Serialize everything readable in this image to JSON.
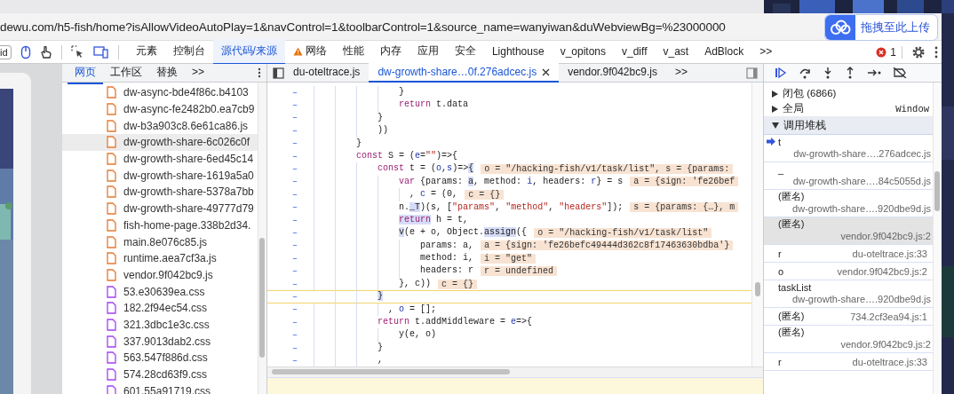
{
  "browser": {
    "url": "dewu.com/h5-fish/home?isAllowVideoAutoPlay=1&navControl=1&toolbarControl=1&source_name=wanyiwan&duWebviewBg=%23000000",
    "upload_button": "拖拽至此上传"
  },
  "devtools": {
    "search_field": "id",
    "tabs": [
      {
        "label": "元素",
        "selected": false,
        "warning": false
      },
      {
        "label": "控制台",
        "selected": false,
        "warning": false
      },
      {
        "label": "源代码/来源",
        "selected": true,
        "warning": false
      },
      {
        "label": "网络",
        "selected": false,
        "warning": true
      },
      {
        "label": "性能",
        "selected": false,
        "warning": false
      },
      {
        "label": "内存",
        "selected": false,
        "warning": false
      },
      {
        "label": "应用",
        "selected": false,
        "warning": false
      },
      {
        "label": "安全",
        "selected": false,
        "warning": false
      },
      {
        "label": "Lighthouse",
        "selected": false,
        "warning": false
      },
      {
        "label": "v_opitons",
        "selected": false,
        "warning": false
      },
      {
        "label": "v_diff",
        "selected": false,
        "warning": false
      },
      {
        "label": "v_ast",
        "selected": false,
        "warning": false
      },
      {
        "label": "AdBlock",
        "selected": false,
        "warning": false
      }
    ],
    "more": ">>",
    "error_count": "1"
  },
  "navigator": {
    "tabs": [
      {
        "label": "网页",
        "selected": true
      },
      {
        "label": "工作区",
        "selected": false
      },
      {
        "label": "替换",
        "selected": false
      }
    ],
    "more": ">>",
    "files": [
      {
        "name": "dw-async-bde4f86c.b4103",
        "kind": "js",
        "selected": false
      },
      {
        "name": "dw-async-fe2482b0.ea7cb9",
        "kind": "js",
        "selected": false
      },
      {
        "name": "dw-b3a903c8.6e61ca86.js",
        "kind": "js",
        "selected": false
      },
      {
        "name": "dw-growth-share-6c026c0f",
        "kind": "js",
        "selected": true
      },
      {
        "name": "dw-growth-share-6ed45c14",
        "kind": "js",
        "selected": false
      },
      {
        "name": "dw-growth-share-1619a5a0",
        "kind": "js",
        "selected": false
      },
      {
        "name": "dw-growth-share-5378a7bb",
        "kind": "js",
        "selected": false
      },
      {
        "name": "dw-growth-share-49777d79",
        "kind": "js",
        "selected": false
      },
      {
        "name": "fish-home-page.338b2d34.",
        "kind": "js",
        "selected": false
      },
      {
        "name": "main.8e076c85.js",
        "kind": "js",
        "selected": false
      },
      {
        "name": "runtime.aea7cf3a.js",
        "kind": "js",
        "selected": false
      },
      {
        "name": "vendor.9f042bc9.js",
        "kind": "js",
        "selected": false
      },
      {
        "name": "53.e30639ea.css",
        "kind": "css",
        "selected": false
      },
      {
        "name": "182.2f94ec54.css",
        "kind": "css",
        "selected": false
      },
      {
        "name": "321.3dbc1e3c.css",
        "kind": "css",
        "selected": false
      },
      {
        "name": "337.9013dab2.css",
        "kind": "css",
        "selected": false
      },
      {
        "name": "563.547f886d.css",
        "kind": "css",
        "selected": false
      },
      {
        "name": "574.28cd63f9.css",
        "kind": "css",
        "selected": false
      },
      {
        "name": "601.55a91719.css",
        "kind": "css",
        "selected": false
      }
    ]
  },
  "editor": {
    "tabs": [
      {
        "label": "du-oteltrace.js",
        "selected": false
      },
      {
        "label": "dw-growth-share…0f.276adcec.js",
        "selected": true
      },
      {
        "label": "vendor.9f042bc9.js",
        "selected": false
      }
    ],
    "more": ">>",
    "lines": [
      {
        "gutter": "–",
        "current": false,
        "tokens": [
          {
            "kind": "plain",
            "text": "                }"
          }
        ]
      },
      {
        "gutter": "–",
        "current": false,
        "tokens": [
          {
            "kind": "keyword",
            "text": "                return"
          },
          {
            "kind": "plain",
            "text": " t.data"
          }
        ]
      },
      {
        "gutter": "–",
        "current": false,
        "tokens": [
          {
            "kind": "plain",
            "text": "            }"
          }
        ]
      },
      {
        "gutter": "–",
        "current": false,
        "tokens": [
          {
            "kind": "plain",
            "text": "            ))"
          }
        ]
      },
      {
        "gutter": "–",
        "current": false,
        "tokens": [
          {
            "kind": "plain",
            "text": "        }"
          }
        ]
      },
      {
        "gutter": "–",
        "current": false,
        "tokens": [
          {
            "kind": "keyword",
            "text": "        const"
          },
          {
            "kind": "plain",
            "text": " S = ("
          },
          {
            "kind": "ident",
            "text": "e"
          },
          {
            "kind": "plain",
            "text": "="
          },
          {
            "kind": "string",
            "text": "\"\""
          },
          {
            "kind": "plain",
            "text": ")=>{"
          }
        ]
      },
      {
        "gutter": "–",
        "current": false,
        "tokens": [
          {
            "kind": "keyword",
            "text": "            const"
          },
          {
            "kind": "plain",
            "text": " t = ("
          },
          {
            "kind": "ident",
            "text": "o"
          },
          {
            "kind": "plain",
            "text": ","
          },
          {
            "kind": "ident",
            "text": "s"
          },
          {
            "kind": "plain",
            "text": ")=>"
          },
          {
            "kind": "mark",
            "text": "{"
          }
        ],
        "values": [
          "o = \"/hacking-fish/v1/task/list\", s = {params:"
        ]
      },
      {
        "gutter": "–",
        "current": false,
        "tokens": [
          {
            "kind": "keyword",
            "text": "                var"
          },
          {
            "kind": "plain",
            "text": " {params: "
          },
          {
            "kind": "mark",
            "text": "a"
          },
          {
            "kind": "plain",
            "text": ", method: "
          },
          {
            "kind": "ident",
            "text": "i"
          },
          {
            "kind": "plain",
            "text": ", headers: "
          },
          {
            "kind": "ident",
            "text": "r"
          },
          {
            "kind": "plain",
            "text": "} = s"
          }
        ],
        "values": [
          "a = {sign: 'fe26bef"
        ]
      },
      {
        "gutter": "–",
        "current": false,
        "tokens": [
          {
            "kind": "plain",
            "text": "                  , "
          },
          {
            "kind": "ident",
            "text": "c"
          },
          {
            "kind": "plain",
            "text": " = (0,"
          }
        ],
        "values": [
          "c = {}"
        ]
      },
      {
        "gutter": "–",
        "current": false,
        "tokens": [
          {
            "kind": "plain",
            "text": "                n."
          },
          {
            "kind": "mark",
            "text": "_T"
          },
          {
            "kind": "plain",
            "text": ")(s, ["
          },
          {
            "kind": "string",
            "text": "\"params\""
          },
          {
            "kind": "plain",
            "text": ", "
          },
          {
            "kind": "string",
            "text": "\"method\""
          },
          {
            "kind": "plain",
            "text": ", "
          },
          {
            "kind": "string",
            "text": "\"headers\""
          },
          {
            "kind": "plain",
            "text": "]);"
          }
        ],
        "values": [
          "s = {params: {…}, m"
        ]
      },
      {
        "gutter": "–",
        "current": false,
        "tokens": [
          {
            "kind": "mark-keyword",
            "text": "                return"
          },
          {
            "kind": "plain",
            "text": " h = t,"
          }
        ]
      },
      {
        "gutter": "–",
        "current": false,
        "tokens": [
          {
            "kind": "mark",
            "text": "                v"
          },
          {
            "kind": "plain",
            "text": "(e + o, Object."
          },
          {
            "kind": "mark",
            "text": "assign"
          },
          {
            "kind": "plain",
            "text": "({"
          }
        ],
        "values": [
          "o = \"/hacking-fish/v1/task/list\""
        ]
      },
      {
        "gutter": "–",
        "current": false,
        "tokens": [
          {
            "kind": "plain",
            "text": "                    params: a,"
          }
        ],
        "values": [
          "a = {sign: 'fe26befc49444d362c8f17463630bdba'}"
        ]
      },
      {
        "gutter": "–",
        "current": false,
        "tokens": [
          {
            "kind": "plain",
            "text": "                    method: i,"
          }
        ],
        "values": [
          "i = \"get\""
        ]
      },
      {
        "gutter": "–",
        "current": false,
        "tokens": [
          {
            "kind": "plain",
            "text": "                    headers: r"
          }
        ],
        "values": [
          "r = undefined"
        ]
      },
      {
        "gutter": "–",
        "current": false,
        "tokens": [
          {
            "kind": "plain",
            "text": "                }, c))"
          }
        ],
        "values": [
          "c = {}"
        ]
      },
      {
        "gutter": "–",
        "current": true,
        "tokens": [
          {
            "kind": "mark",
            "text": "            }"
          }
        ]
      },
      {
        "gutter": "–",
        "current": false,
        "tokens": [
          {
            "kind": "plain",
            "text": "              , "
          },
          {
            "kind": "ident",
            "text": "o"
          },
          {
            "kind": "plain",
            "text": " = [];"
          }
        ]
      },
      {
        "gutter": "–",
        "current": false,
        "tokens": [
          {
            "kind": "keyword",
            "text": "            return"
          },
          {
            "kind": "plain",
            "text": " t.addMiddleware = "
          },
          {
            "kind": "ident",
            "text": "e"
          },
          {
            "kind": "plain",
            "text": "=>{"
          }
        ]
      },
      {
        "gutter": "–",
        "current": false,
        "tokens": [
          {
            "kind": "plain",
            "text": "                y(e, o)"
          }
        ]
      },
      {
        "gutter": "–",
        "current": false,
        "tokens": [
          {
            "kind": "plain",
            "text": "            }"
          }
        ]
      },
      {
        "gutter": "–",
        "current": false,
        "tokens": [
          {
            "kind": "plain",
            "text": "            ,"
          }
        ]
      }
    ]
  },
  "debugger": {
    "scopes": [
      {
        "label": "闭包 (6866)"
      },
      {
        "label": "全局",
        "value": "Window"
      }
    ],
    "call_stack": {
      "title": "调用堆栈",
      "expanded": true,
      "frames": [
        {
          "name": "t",
          "location": "dw-growth-share….276adcec.js",
          "kind": "stacked",
          "current": true,
          "selected": false
        },
        {
          "name": "_",
          "location": "dw-growth-share….84c5055d.js",
          "kind": "stacked",
          "current": false,
          "selected": false
        },
        {
          "name": "(匿名)",
          "location": "dw-growth-share….920dbe9d.js",
          "kind": "stacked",
          "current": false,
          "selected": false
        },
        {
          "name": "(匿名)",
          "location": "vendor.9f042bc9.js:2",
          "kind": "stacked",
          "current": false,
          "selected": true
        },
        {
          "name": "r",
          "location": "du-oteltrace.js:33",
          "kind": "inline",
          "current": false,
          "selected": false
        },
        {
          "name": "o",
          "location": "vendor.9f042bc9.js:2",
          "kind": "inline",
          "current": false,
          "selected": false
        },
        {
          "name": "taskList",
          "location": "dw-growth-share….920dbe9d.js",
          "kind": "stacked",
          "current": false,
          "selected": false
        },
        {
          "name": "(匿名)",
          "location": "734.2cf3ea94.js:1",
          "kind": "inline",
          "current": false,
          "selected": false
        },
        {
          "name": "(匿名)",
          "location": "vendor.9f042bc9.js:2",
          "kind": "stacked",
          "current": false,
          "selected": false
        },
        {
          "name": "r",
          "location": "du-oteltrace.js:33",
          "kind": "inline",
          "current": false,
          "selected": false
        }
      ]
    }
  }
}
